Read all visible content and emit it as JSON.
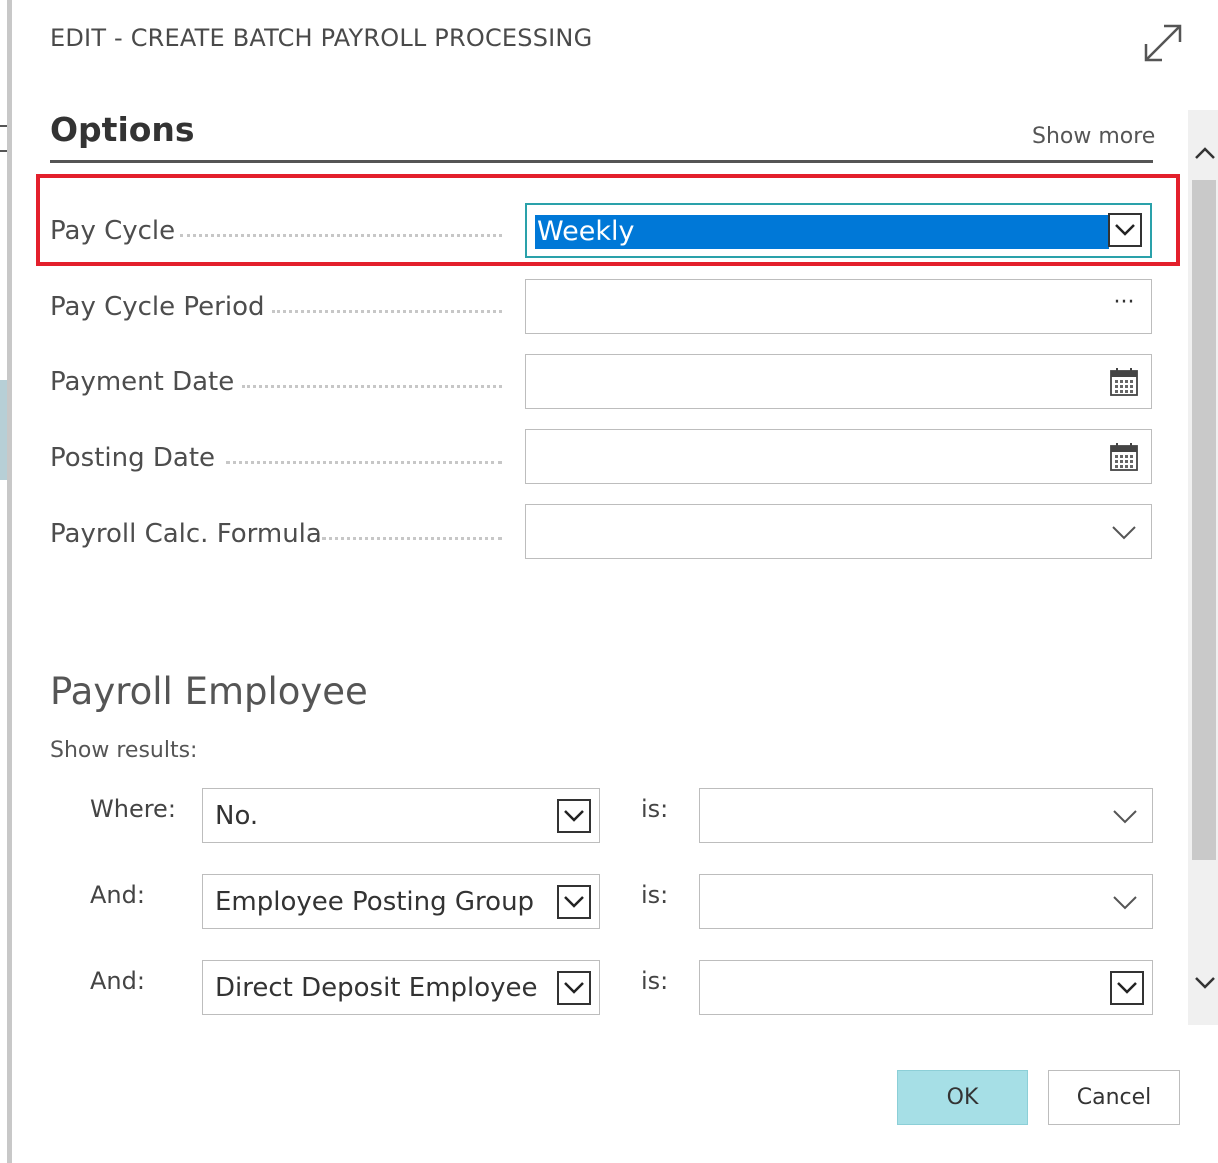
{
  "dialog": {
    "title": "EDIT - CREATE BATCH PAYROLL PROCESSING"
  },
  "options": {
    "heading": "Options",
    "show_more": "Show more",
    "fields": [
      {
        "label": "Pay Cycle",
        "value": "Weekly",
        "control": "dropdown-selected"
      },
      {
        "label": "Pay Cycle Period",
        "value": "",
        "control": "lookup-ellipsis"
      },
      {
        "label": "Payment Date",
        "value": "",
        "control": "date-picker"
      },
      {
        "label": "Posting Date",
        "value": "",
        "control": "date-picker"
      },
      {
        "label": "Payroll Calc. Formula",
        "value": "",
        "control": "dropdown"
      }
    ],
    "ellipsis": "···"
  },
  "payroll_employee": {
    "heading": "Payroll Employee",
    "show_results": "Show results:",
    "filters": [
      {
        "conjunction": "Where:",
        "field": "No.",
        "is": "is:",
        "value": ""
      },
      {
        "conjunction": "And:",
        "field": "Employee Posting Group",
        "is": "is:",
        "value": ""
      },
      {
        "conjunction": "And:",
        "field": "Direct Deposit Employee",
        "is": "is:",
        "value": ""
      }
    ]
  },
  "buttons": {
    "ok": "OK",
    "cancel": "Cancel"
  },
  "colors": {
    "selection": "#0078d7",
    "highlight_border": "#e3202c",
    "ok_button": "#a6dfe6",
    "focus_border": "#2aa1aa"
  },
  "icons": [
    "expand-icon",
    "chevron-down-icon",
    "ellipsis-icon",
    "calendar-icon",
    "scroll-up-icon",
    "scroll-down-icon"
  ]
}
